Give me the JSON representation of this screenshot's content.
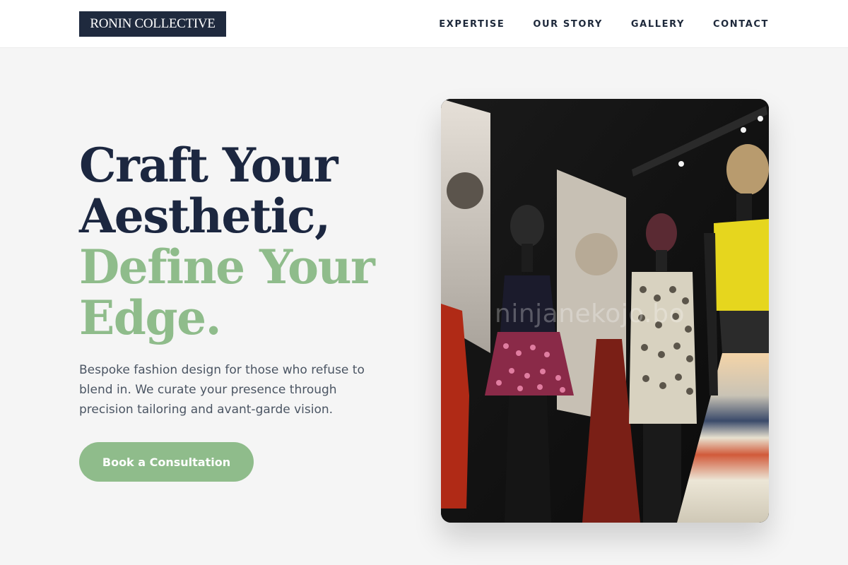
{
  "brand": {
    "name": "RONIN COLLECTIVE"
  },
  "nav": {
    "items": [
      {
        "label": "EXPERTISE"
      },
      {
        "label": "OUR STORY"
      },
      {
        "label": "GALLERY"
      },
      {
        "label": "CONTACT"
      }
    ]
  },
  "hero": {
    "headline": {
      "line1": "Craft Your",
      "line2": "Aesthetic,",
      "line3": "Define Your",
      "line4": "Edge."
    },
    "description": "Bespoke fashion design for those who refuse to blend in. We curate your presence through precision tailoring and avant-garde vision.",
    "cta_label": "Book a Consultation",
    "image": {
      "watermark": "ninjanekojo.bo"
    }
  },
  "colors": {
    "navy": "#1f2a3e",
    "accent_green": "#8fbc8b",
    "background": "#f5f5f5"
  }
}
